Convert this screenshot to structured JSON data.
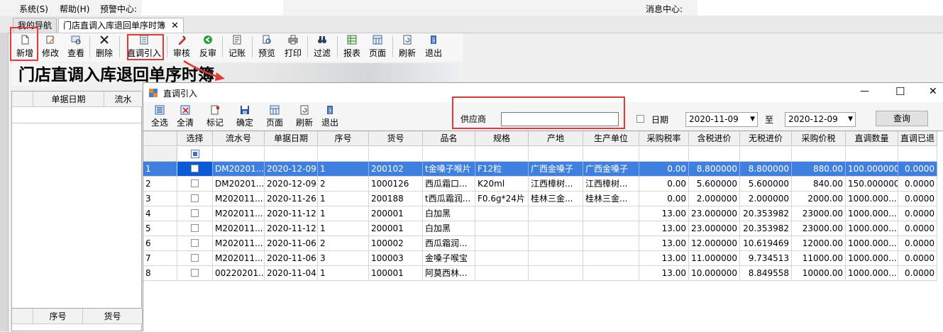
{
  "menubar": {
    "items": [
      "系统(S)",
      "帮助(H)",
      "预警中心:"
    ],
    "message_center": "消息中心:"
  },
  "tabs": [
    {
      "label": "我的导航"
    },
    {
      "label": "门店直调入库退回单序时簿",
      "close": "✕"
    }
  ],
  "toolbar": {
    "buttons": [
      "新增",
      "修改",
      "查看",
      "删除",
      "直调引入",
      "审核",
      "反审",
      "记账",
      "预览",
      "打印",
      "过滤",
      "报表",
      "页面",
      "刷新",
      "退出"
    ]
  },
  "background_form": {
    "title": "门店直调入库退回单序时簿",
    "top_headers": [
      "单据日期",
      "流水"
    ],
    "bottom_headers": [
      "序号",
      "货号"
    ]
  },
  "dialog": {
    "title": "直调引入",
    "window_controls": {
      "minimize": "—",
      "maximize": "☐",
      "close": "✕"
    },
    "toolbar": [
      "全选",
      "全清",
      "标记",
      "确定",
      "页面",
      "刷新",
      "退出"
    ],
    "supplier_label": "供应商",
    "supplier_value": "",
    "date_label": "日期",
    "date_from": "2020-11-09",
    "to_label": "至",
    "date_to": "2020-12-09",
    "query_button": "查询"
  },
  "grid": {
    "columns": [
      "选择",
      "流水号",
      "单据日期",
      "序号",
      "货号",
      "品名",
      "规格",
      "产地",
      "生产单位",
      "采购税率",
      "含税进价",
      "无税进价",
      "采购价税",
      "直调数量",
      "直调已退"
    ],
    "rows": [
      [
        "1",
        "DM20201...",
        "2020-12-09",
        "1",
        "200102",
        "t金嗓子喉片",
        "F12粒",
        "广西金嗓子",
        "广西金嗓子",
        "0.00",
        "8.800000",
        "8.800000",
        "880.00",
        "100.000000",
        "0.0000"
      ],
      [
        "2",
        "DM20201...",
        "2020-12-09",
        "2",
        "1000126",
        "西瓜霜口...",
        "K20ml",
        "江西樟树...",
        "江西樟树...",
        "0.00",
        "5.600000",
        "5.600000",
        "840.00",
        "150.000000",
        "0.0000"
      ],
      [
        "3",
        "M202011...",
        "2020-11-26",
        "1",
        "200188",
        "t西瓜霜润...",
        "F0.6g*24片",
        "桂林三金...",
        "桂林三金...",
        "0.00",
        "2.000000",
        "2.000000",
        "2000.00",
        "1000.000...",
        "0.0000"
      ],
      [
        "4",
        "M202011...",
        "2020-11-12",
        "1",
        "200001",
        "白加黑",
        "",
        "",
        "",
        "13.00",
        "23.000000",
        "20.353982",
        "23000.00",
        "1000.000...",
        "0.0000"
      ],
      [
        "5",
        "M202011...",
        "2020-11-12",
        "1",
        "200001",
        "白加黑",
        "",
        "",
        "",
        "13.00",
        "23.000000",
        "20.353982",
        "23000.00",
        "1000.000...",
        "0.0000"
      ],
      [
        "6",
        "M202011...",
        "2020-11-06",
        "2",
        "100002",
        "西瓜霜润...",
        "",
        "",
        "",
        "13.00",
        "12.000000",
        "10.619469",
        "12000.00",
        "1000.000...",
        "0.0000"
      ],
      [
        "7",
        "M202011...",
        "2020-11-06",
        "3",
        "100003",
        "金嗓子喉宝",
        "",
        "",
        "",
        "13.00",
        "11.000000",
        "9.734513",
        "11000.00",
        "1000.000...",
        "0.0000"
      ],
      [
        "8",
        "00220201...",
        "2020-11-04",
        "1",
        "100001",
        "阿莫西林...",
        "",
        "",
        "",
        "13.00",
        "10.000000",
        "8.849558",
        "10000.00",
        "1000.000...",
        "0.0000"
      ]
    ]
  },
  "colors": {
    "highlight_box": "#e53935",
    "selected_row": "#3f7fe0",
    "selected_cell": "#0a59d6"
  }
}
